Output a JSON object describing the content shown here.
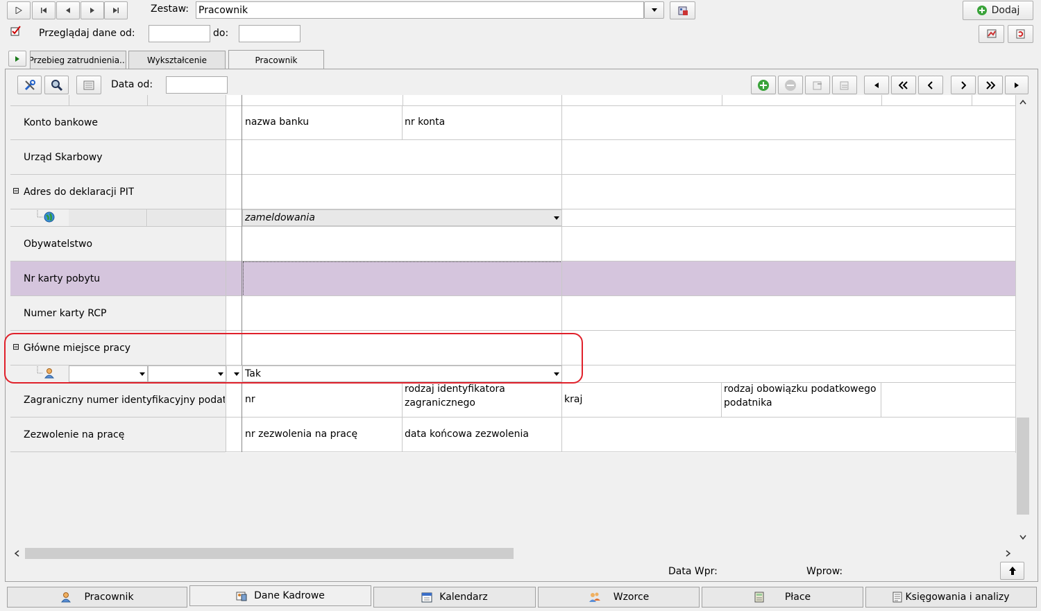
{
  "toolbar": {
    "nav_icons": [
      "play-first-icon",
      "first-record-icon",
      "prev-record-icon",
      "next-record-icon",
      "last-record-icon"
    ],
    "zestaw_label": "Zestaw:",
    "zestaw_value": "Pracownik",
    "add_label": "Dodaj",
    "przegladaj_label": "Przeglądaj dane od:",
    "do_label": "do:",
    "od_value": "",
    "do_value": ""
  },
  "tabs": [
    {
      "label": "Przebieg zatrudnienia..."
    },
    {
      "label": "Wykształcenie"
    },
    {
      "label": "Pracownik"
    }
  ],
  "inner_toolbar": {
    "data_od_label": "Data od:",
    "data_od_value": ""
  },
  "rows": [
    {
      "label": "Konto bankowe",
      "c1": "nazwa banku",
      "c2": "nr konta"
    },
    {
      "label": "Urząd Skarbowy"
    },
    {
      "label": "Adres do deklaracji PIT",
      "expand": "⊟"
    },
    {
      "sub_value": "zameldowania"
    },
    {
      "label": "Obywatelstwo"
    },
    {
      "label": "Nr karty pobytu"
    },
    {
      "label": "Numer karty RCP"
    },
    {
      "label": "Główne miejsce pracy",
      "expand": "⊟"
    },
    {
      "sub_value": "Tak"
    },
    {
      "label": "Zagraniczny numer identyfikacyjny podatn...",
      "c1": "nr",
      "c2_line1": "rodzaj identyfikatora",
      "c2_line2": "zagranicznego",
      "c3": "kraj",
      "c4_line1": "rodzaj obowiązku podatkowego",
      "c4_line2": "podatnika"
    },
    {
      "label": "Zezwolenie na pracę",
      "c1": "nr zezwolenia na pracę",
      "c2": "data końcowa zezwolenia"
    }
  ],
  "footer": {
    "data_wpr_label": "Data Wpr:",
    "wprow_label": "Wprow:"
  },
  "bottom_tabs": [
    {
      "label": "Pracownik",
      "icon": "person-icon"
    },
    {
      "label": "Dane Kadrowe",
      "icon": "hr-data-icon"
    },
    {
      "label": "Kalendarz",
      "icon": "calendar-icon"
    },
    {
      "label": "Wzorce",
      "icon": "people-icon"
    },
    {
      "label": "Płace",
      "icon": "calculator-icon"
    },
    {
      "label": "Księgowania i analizy",
      "icon": "ledger-icon"
    }
  ],
  "colors": {
    "selected_row": "#d5c5dd",
    "highlight_border": "#e0202a",
    "add_green": "#3aa33a"
  }
}
